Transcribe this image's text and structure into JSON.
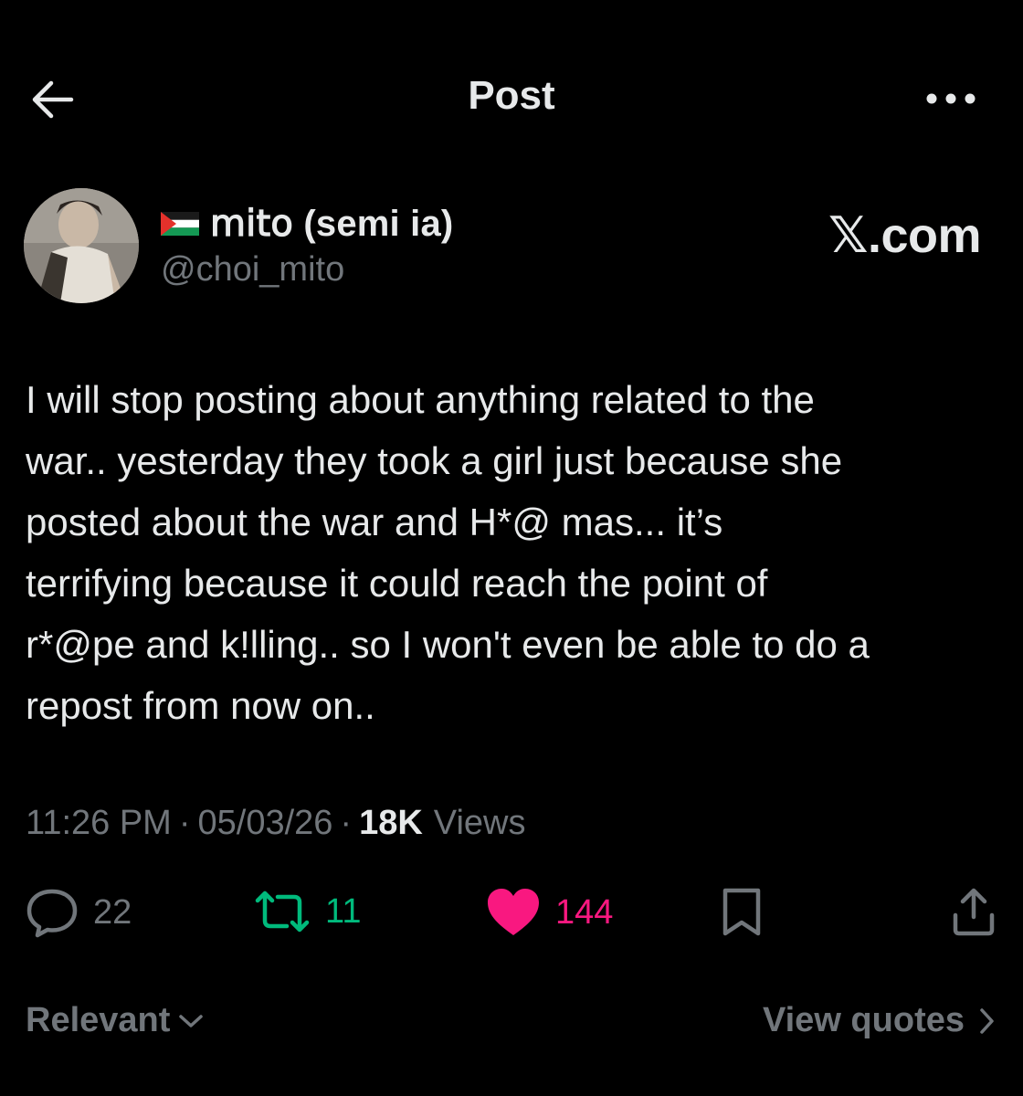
{
  "header": {
    "title": "Post",
    "back_icon": "arrow-left-icon",
    "more_icon": "more-horizontal-icon"
  },
  "author": {
    "flag_icon": "palestine-flag-icon",
    "display_name": "𝗆𝗂𝗍𝗈 (semi ia)",
    "handle": "@choi_mito"
  },
  "source_domain": "𝕏.com",
  "post": {
    "text": "I will stop posting about anything related to the\nwar.. yesterday they took a girl just because she\nposted about the war and H*@ mas... it’s\nterrifying because it could reach the point of\nr*@pe and k!lling.. so I won't even be able to do a\nrepost from now on.."
  },
  "meta": {
    "time": "11:26 PM",
    "separator": "·",
    "date": "05/03/26",
    "views_count": "18K",
    "views_label": "Views"
  },
  "actions": {
    "reply_count": "22",
    "repost_count": "11",
    "like_count": "144"
  },
  "footer": {
    "sort_label": "Relevant",
    "view_quotes_label": "View quotes"
  },
  "colors": {
    "background": "#000000",
    "text_primary": "#e7e9ea",
    "text_secondary": "#71767b",
    "repost_green": "#00ba7c",
    "like_pink": "#f91880"
  }
}
